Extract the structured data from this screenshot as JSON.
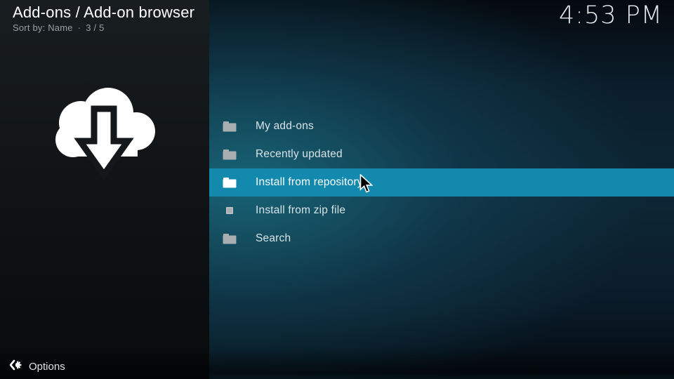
{
  "header": {
    "title": "Add-ons / Add-on browser",
    "sort_label": "Sort by: Name",
    "separator": "·",
    "position_indicator": "3 / 5",
    "clock": "4:53 PM"
  },
  "sidebar": {
    "artwork_icon": "cloud-download-icon"
  },
  "menu": {
    "items": [
      {
        "label": "My add-ons",
        "icon": "folder-icon",
        "selected": false
      },
      {
        "label": "Recently updated",
        "icon": "folder-icon",
        "selected": false
      },
      {
        "label": "Install from repository",
        "icon": "folder-icon",
        "selected": true
      },
      {
        "label": "Install from zip file",
        "icon": "file-icon",
        "selected": false
      },
      {
        "label": "Search",
        "icon": "folder-icon",
        "selected": false
      }
    ]
  },
  "footer": {
    "options_label": "Options",
    "options_icon": "options-gear-icon"
  },
  "colors": {
    "accent": "#1389ae",
    "sidebar-top": "#181d20",
    "content-glow": "#1a6e82",
    "text": "#d9e3e7",
    "muted-text": "#97a0a4",
    "clock-text": "#e4e9ec",
    "folder-gray": "#a9aeb1"
  }
}
